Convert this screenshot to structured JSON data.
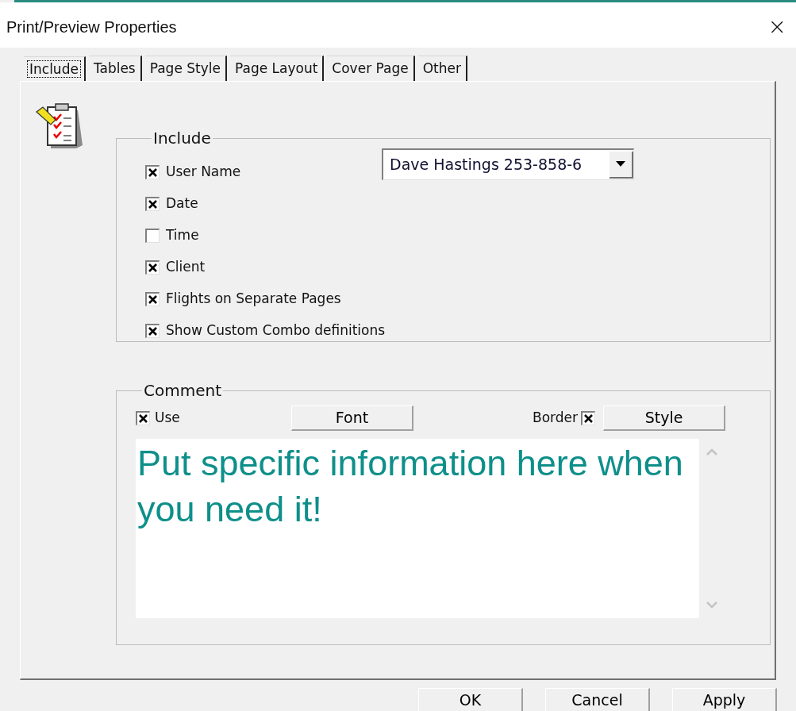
{
  "window": {
    "title": "Print/Preview Properties",
    "close": "×"
  },
  "tabs": [
    {
      "label": "Include",
      "selected": true
    },
    {
      "label": "Tables",
      "selected": false
    },
    {
      "label": "Page Style",
      "selected": false
    },
    {
      "label": "Page Layout",
      "selected": false
    },
    {
      "label": "Cover Page",
      "selected": false
    },
    {
      "label": "Other",
      "selected": false
    }
  ],
  "include": {
    "title": "Include",
    "user_dropdown": {
      "value": "Dave Hastings 253-858-6"
    },
    "options": [
      {
        "label": "User Name",
        "checked": true
      },
      {
        "label": "Date",
        "checked": true
      },
      {
        "label": "Time",
        "checked": false
      },
      {
        "label": "Client",
        "checked": true
      },
      {
        "label": "Flights on Separate Pages",
        "checked": true
      },
      {
        "label": "Show Custom Combo definitions",
        "checked": true
      }
    ]
  },
  "comment": {
    "title": "Comment",
    "use": {
      "label": "Use",
      "checked": true
    },
    "font_button": "Font",
    "border": {
      "label": "Border",
      "checked": true
    },
    "style_button": "Style",
    "text": "Put specific information here when you need it!"
  },
  "buttons": [
    "OK",
    "Cancel",
    "Apply"
  ]
}
